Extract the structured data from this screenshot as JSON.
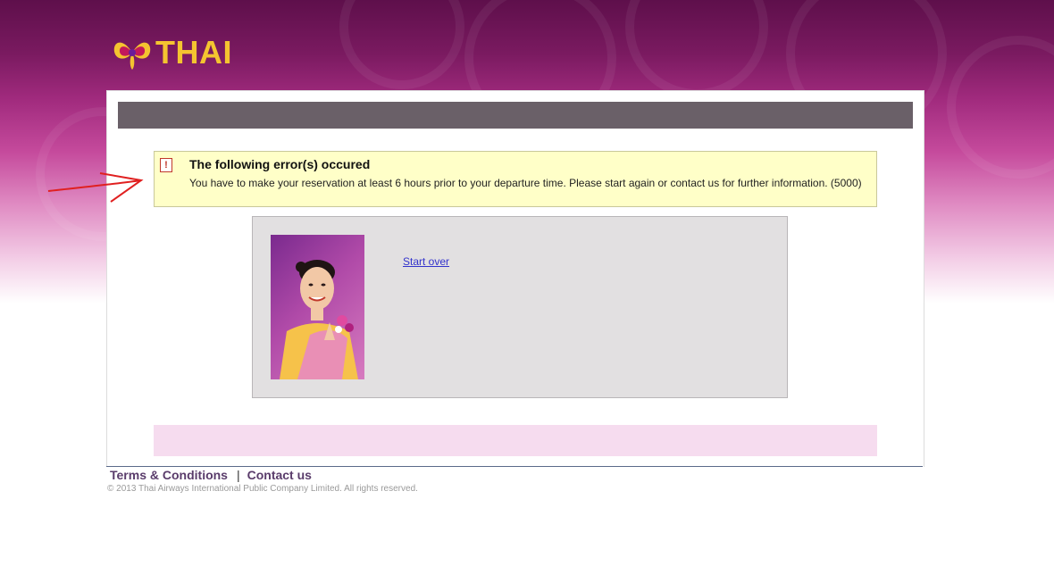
{
  "brand": {
    "logo_text": "THAI",
    "logo_color": "#f4c430",
    "header_color": "#5e0f4b"
  },
  "error": {
    "title": "The following error(s) occured",
    "message": "You have to make your reservation at least 6 hours prior to your departure time. Please start again or contact us for further information. (5000)",
    "icon": "error-icon"
  },
  "panel": {
    "start_over_label": "Start over"
  },
  "footer": {
    "terms_label": "Terms & Conditions",
    "separator": "|",
    "contact_label": "Contact us",
    "copyright": "© 2013 Thai Airways International Public Company Limited. All rights reserved."
  }
}
